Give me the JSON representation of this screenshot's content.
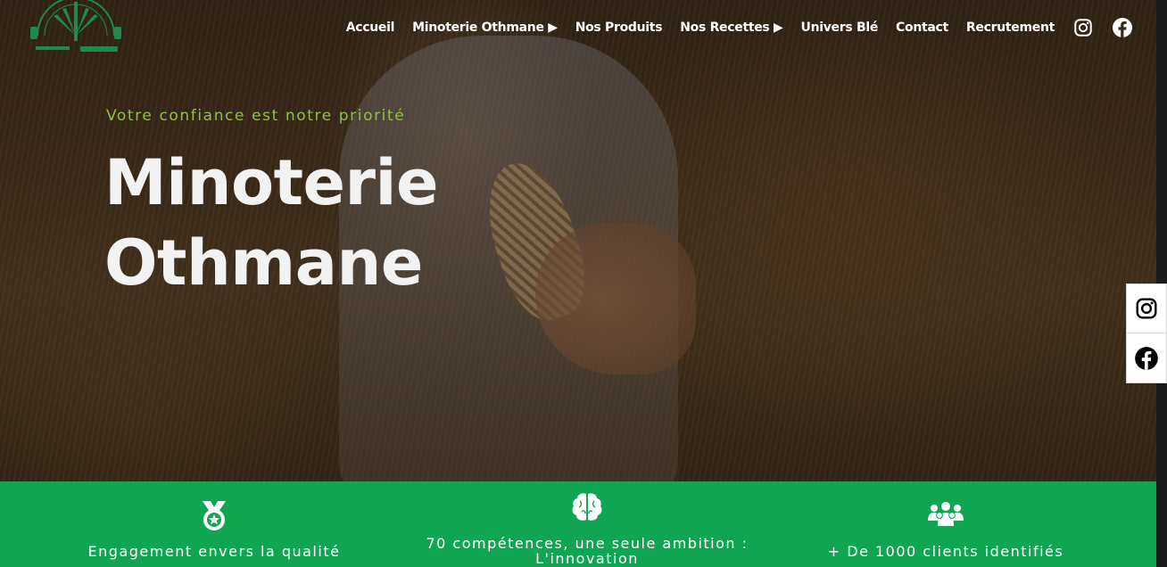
{
  "header": {
    "logo_alt": "Minoterie Othmane",
    "nav": [
      {
        "label": "Accueil"
      },
      {
        "label": "Minoterie Othmane ▶"
      },
      {
        "label": "Nos Produits"
      },
      {
        "label": "Nos Recettes ▶"
      },
      {
        "label": "Univers Blé"
      },
      {
        "label": "Contact"
      },
      {
        "label": "Recrutement"
      }
    ],
    "social": [
      "instagram-icon",
      "facebook-icon"
    ]
  },
  "hero": {
    "tagline": "Votre confiance est notre priorité",
    "title_line1": "Minoterie",
    "title_line2": "Othmane"
  },
  "floating_social": [
    "instagram-icon",
    "facebook-icon"
  ],
  "features": [
    {
      "icon": "medal-icon",
      "text": "Engagement envers la qualité"
    },
    {
      "icon": "brain-icon",
      "text_line1": "70 compétences, une seule ambition :",
      "text_line2": "L'innovation"
    },
    {
      "icon": "users-icon",
      "text": "+ De 1000 clients identifiés"
    }
  ],
  "colors": {
    "brand_green": "#10a550",
    "tagline_green": "#8fc04a",
    "title_white": "#f2f2f2"
  }
}
